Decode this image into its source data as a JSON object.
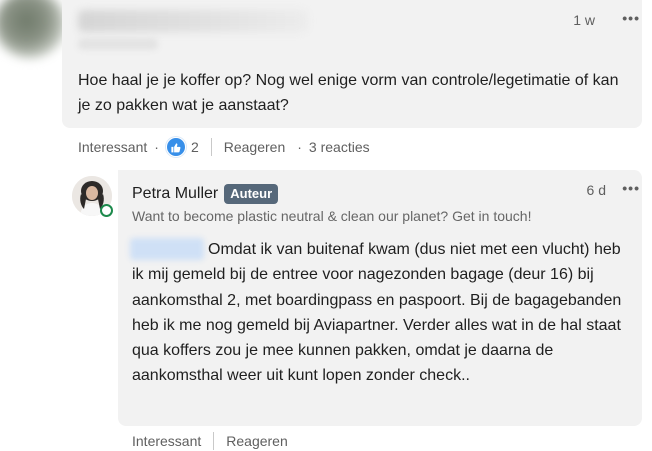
{
  "top_comment": {
    "time": "1 w",
    "more_glyph": "•••",
    "text": "Hoe haal je je koffer op? Nog wel enige vorm van controle/legetimatie of kan je zo pakken wat je aanstaat?",
    "actions": {
      "interesting": "Interessant",
      "reaction_count": "2",
      "reply": "Reageren",
      "replies": "3 reacties"
    }
  },
  "reply": {
    "author": "Petra Muller",
    "badge": "Auteur",
    "headline": "Want to become plastic neutral & clean our planet? Get in touch!",
    "time": "6 d",
    "more_glyph": "•••",
    "text": "Omdat ik van buitenaf kwam (dus niet met een vlucht) heb ik mij gemeld bij de entree voor nagezonden bagage (deur 16) bij aankomsthal 2, met boardingpass en paspoort. Bij de bagagebanden heb ik me nog gemeld bij Aviapartner. Verder alles wat in de hal staat qua koffers zou je mee kunnen pakken, omdat je daarna de aankomsthal weer uit kunt lopen zonder check..",
    "actions": {
      "interesting": "Interessant",
      "reply": "Reageren"
    }
  },
  "colors": {
    "bubble": "#f2f2f2",
    "like_blue": "#378fe9",
    "badge_bg": "#56687a",
    "online_green": "#1d8a4c"
  }
}
